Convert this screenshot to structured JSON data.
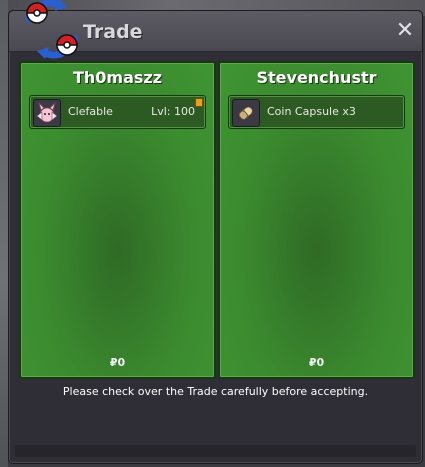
{
  "window": {
    "title": "Trade",
    "close_glyph": "✕"
  },
  "panels": [
    {
      "player": "Th0maszz",
      "item": {
        "icon": "clefable-sprite-icon",
        "name": "Clefable",
        "level": "Lvl: 100",
        "flagged": true
      },
      "money_symbol": "₽",
      "money": "0"
    },
    {
      "player": "Stevenchustr",
      "item": {
        "icon": "coin-capsule-icon",
        "name": "Coin Capsule",
        "quantity": "x3"
      },
      "money_symbol": "₽",
      "money": "0"
    }
  ],
  "footer": {
    "message": "Please check over the Trade carefully before accepting."
  },
  "colors": {
    "panel_green": "#3f9532",
    "panel_border": "#173810",
    "window_bg": "#2f2d36",
    "titlebar": "#5d5b64"
  }
}
